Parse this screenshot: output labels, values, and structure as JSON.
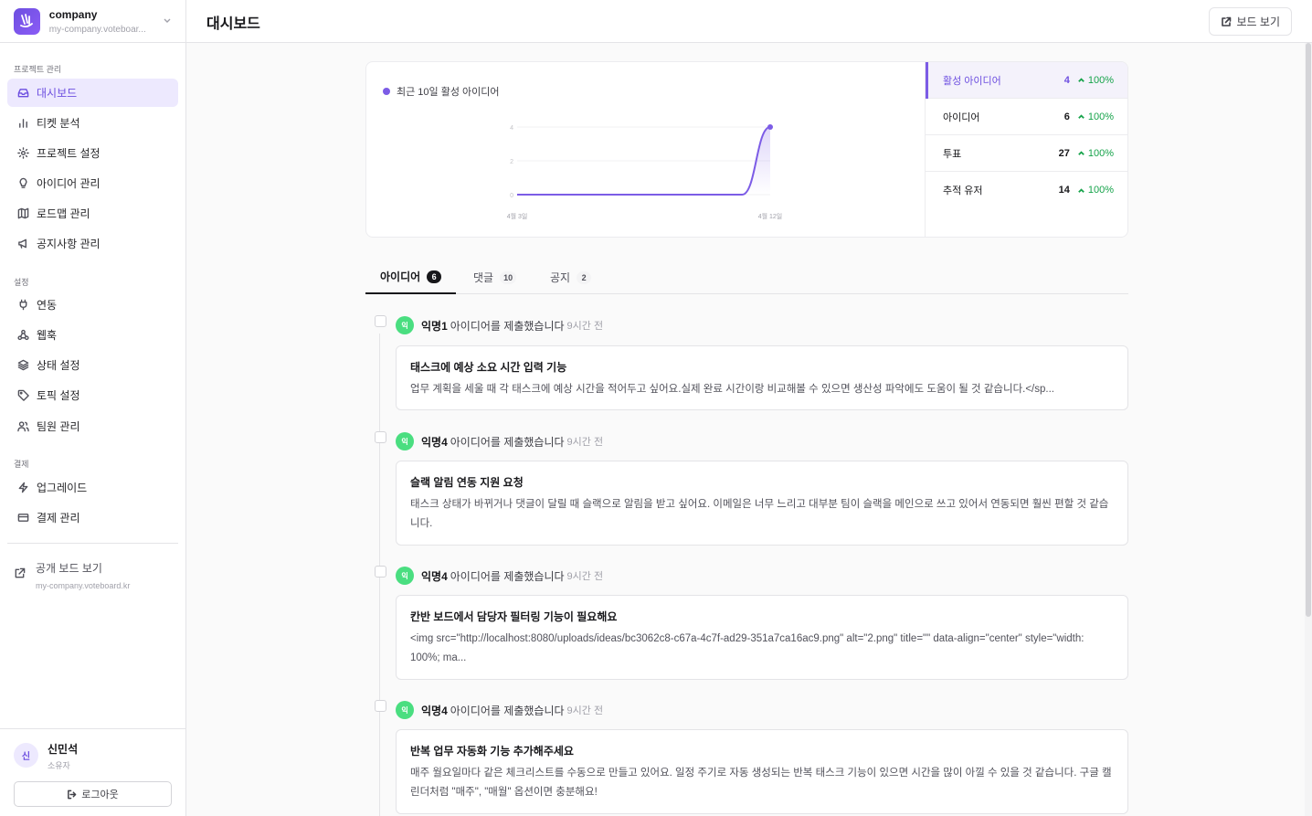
{
  "workspace": {
    "name": "company",
    "domain": "my-company.voteboar..."
  },
  "sidebar": {
    "sections": [
      {
        "label": "프로젝트 관리"
      },
      {
        "label": "설정"
      },
      {
        "label": "결제"
      }
    ],
    "items": [
      {
        "label": "대시보드",
        "icon": "inbox-icon",
        "active": true
      },
      {
        "label": "티켓 분석",
        "icon": "bar-chart-icon"
      },
      {
        "label": "프로젝트 설정",
        "icon": "gear-icon"
      },
      {
        "label": "아이디어 관리",
        "icon": "lightbulb-icon"
      },
      {
        "label": "로드맵 관리",
        "icon": "map-icon"
      },
      {
        "label": "공지사항 관리",
        "icon": "megaphone-icon"
      },
      {
        "label": "연동",
        "icon": "plug-icon"
      },
      {
        "label": "웹훅",
        "icon": "webhook-icon"
      },
      {
        "label": "상태 설정",
        "icon": "layers-icon"
      },
      {
        "label": "토픽 설정",
        "icon": "tag-icon"
      },
      {
        "label": "팀원 관리",
        "icon": "users-icon"
      },
      {
        "label": "업그레이드",
        "icon": "lightning-icon"
      },
      {
        "label": "결제 관리",
        "icon": "credit-card-icon"
      }
    ],
    "public_board": {
      "label": "공개 보드 보기",
      "url": "my-company.voteboard.kr"
    }
  },
  "user": {
    "initial": "신",
    "name": "신민석",
    "role": "소유자",
    "logout_label": "로그아웃"
  },
  "header": {
    "title": "대시보드",
    "view_board_label": "보드 보기"
  },
  "stats": {
    "chart_legend": "최근 10일 활성 아이디어",
    "rows": [
      {
        "label": "활성 아이디어",
        "value": "4",
        "change": "100%"
      },
      {
        "label": "아이디어",
        "value": "6",
        "change": "100%"
      },
      {
        "label": "투표",
        "value": "27",
        "change": "100%"
      },
      {
        "label": "추적 유저",
        "value": "14",
        "change": "100%"
      }
    ]
  },
  "chart_data": {
    "type": "area",
    "x": [
      "4월 3일",
      "4월 4일",
      "4월 5일",
      "4월 6일",
      "4월 7일",
      "4월 8일",
      "4월 9일",
      "4월 10일",
      "4월 11일",
      "4월 12일"
    ],
    "series": [
      {
        "name": "최근 10일 활성 아이디어",
        "values": [
          0,
          0,
          0,
          0,
          0,
          0,
          0,
          0,
          0,
          4
        ]
      }
    ],
    "x_ticks": [
      "4월 3일",
      "4월 12일"
    ],
    "y_ticks": [
      "0",
      "2",
      "4"
    ],
    "ylim": [
      0,
      4
    ],
    "grid": true,
    "color": "#7c5ce6"
  },
  "tabs": [
    {
      "label": "아이디어",
      "count": "6",
      "active": true
    },
    {
      "label": "댓글",
      "count": "10"
    },
    {
      "label": "공지",
      "count": "2"
    }
  ],
  "feed": [
    {
      "avatar": "익",
      "author": "익명1",
      "action": "아이디어를 제출했습니다",
      "time": "9시간 전",
      "title": "태스크에 예상 소요 시간 입력 기능",
      "body": "업무 계획을 세울 때 각 태스크에 예상 시간을 적어두고 싶어요.실제 완료 시간이랑 비교해볼 수 있으면 생산성 파악에도 도움이 될 것 같습니다.</sp..."
    },
    {
      "avatar": "익",
      "author": "익명4",
      "action": "아이디어를 제출했습니다",
      "time": "9시간 전",
      "title": "슬랙 알림 연동 지원 요청",
      "body": "태스크 상태가 바뀌거나 댓글이 달릴 때 슬랙으로 알림을 받고 싶어요. 이메일은 너무 느리고 대부분 팀이 슬랙을 메인으로 쓰고 있어서 연동되면 훨씬 편할 것 같습니다."
    },
    {
      "avatar": "익",
      "author": "익명4",
      "action": "아이디어를 제출했습니다",
      "time": "9시간 전",
      "title": "칸반 보드에서 담당자 필터링 기능이 필요해요",
      "body": "<img src=\"http://localhost:8080/uploads/ideas/bc3062c8-c67a-4c7f-ad29-351a7ca16ac9.png\" alt=\"2.png\" title=\"\" data-align=\"center\" style=\"width: 100%; ma..."
    },
    {
      "avatar": "익",
      "author": "익명4",
      "action": "아이디어를 제출했습니다",
      "time": "9시간 전",
      "title": "반복 업무 자동화 기능 추가해주세요",
      "body": "매주 월요일마다 같은 체크리스트를 수동으로 만들고 있어요. 일정 주기로 자동 생성되는 반복 태스크 기능이 있으면 시간을 많이 아낄 수 있을 것 같습니다. 구글 캘린더처럼 \"매주\", \"매월\" 옵션이면 충분해요!"
    }
  ]
}
